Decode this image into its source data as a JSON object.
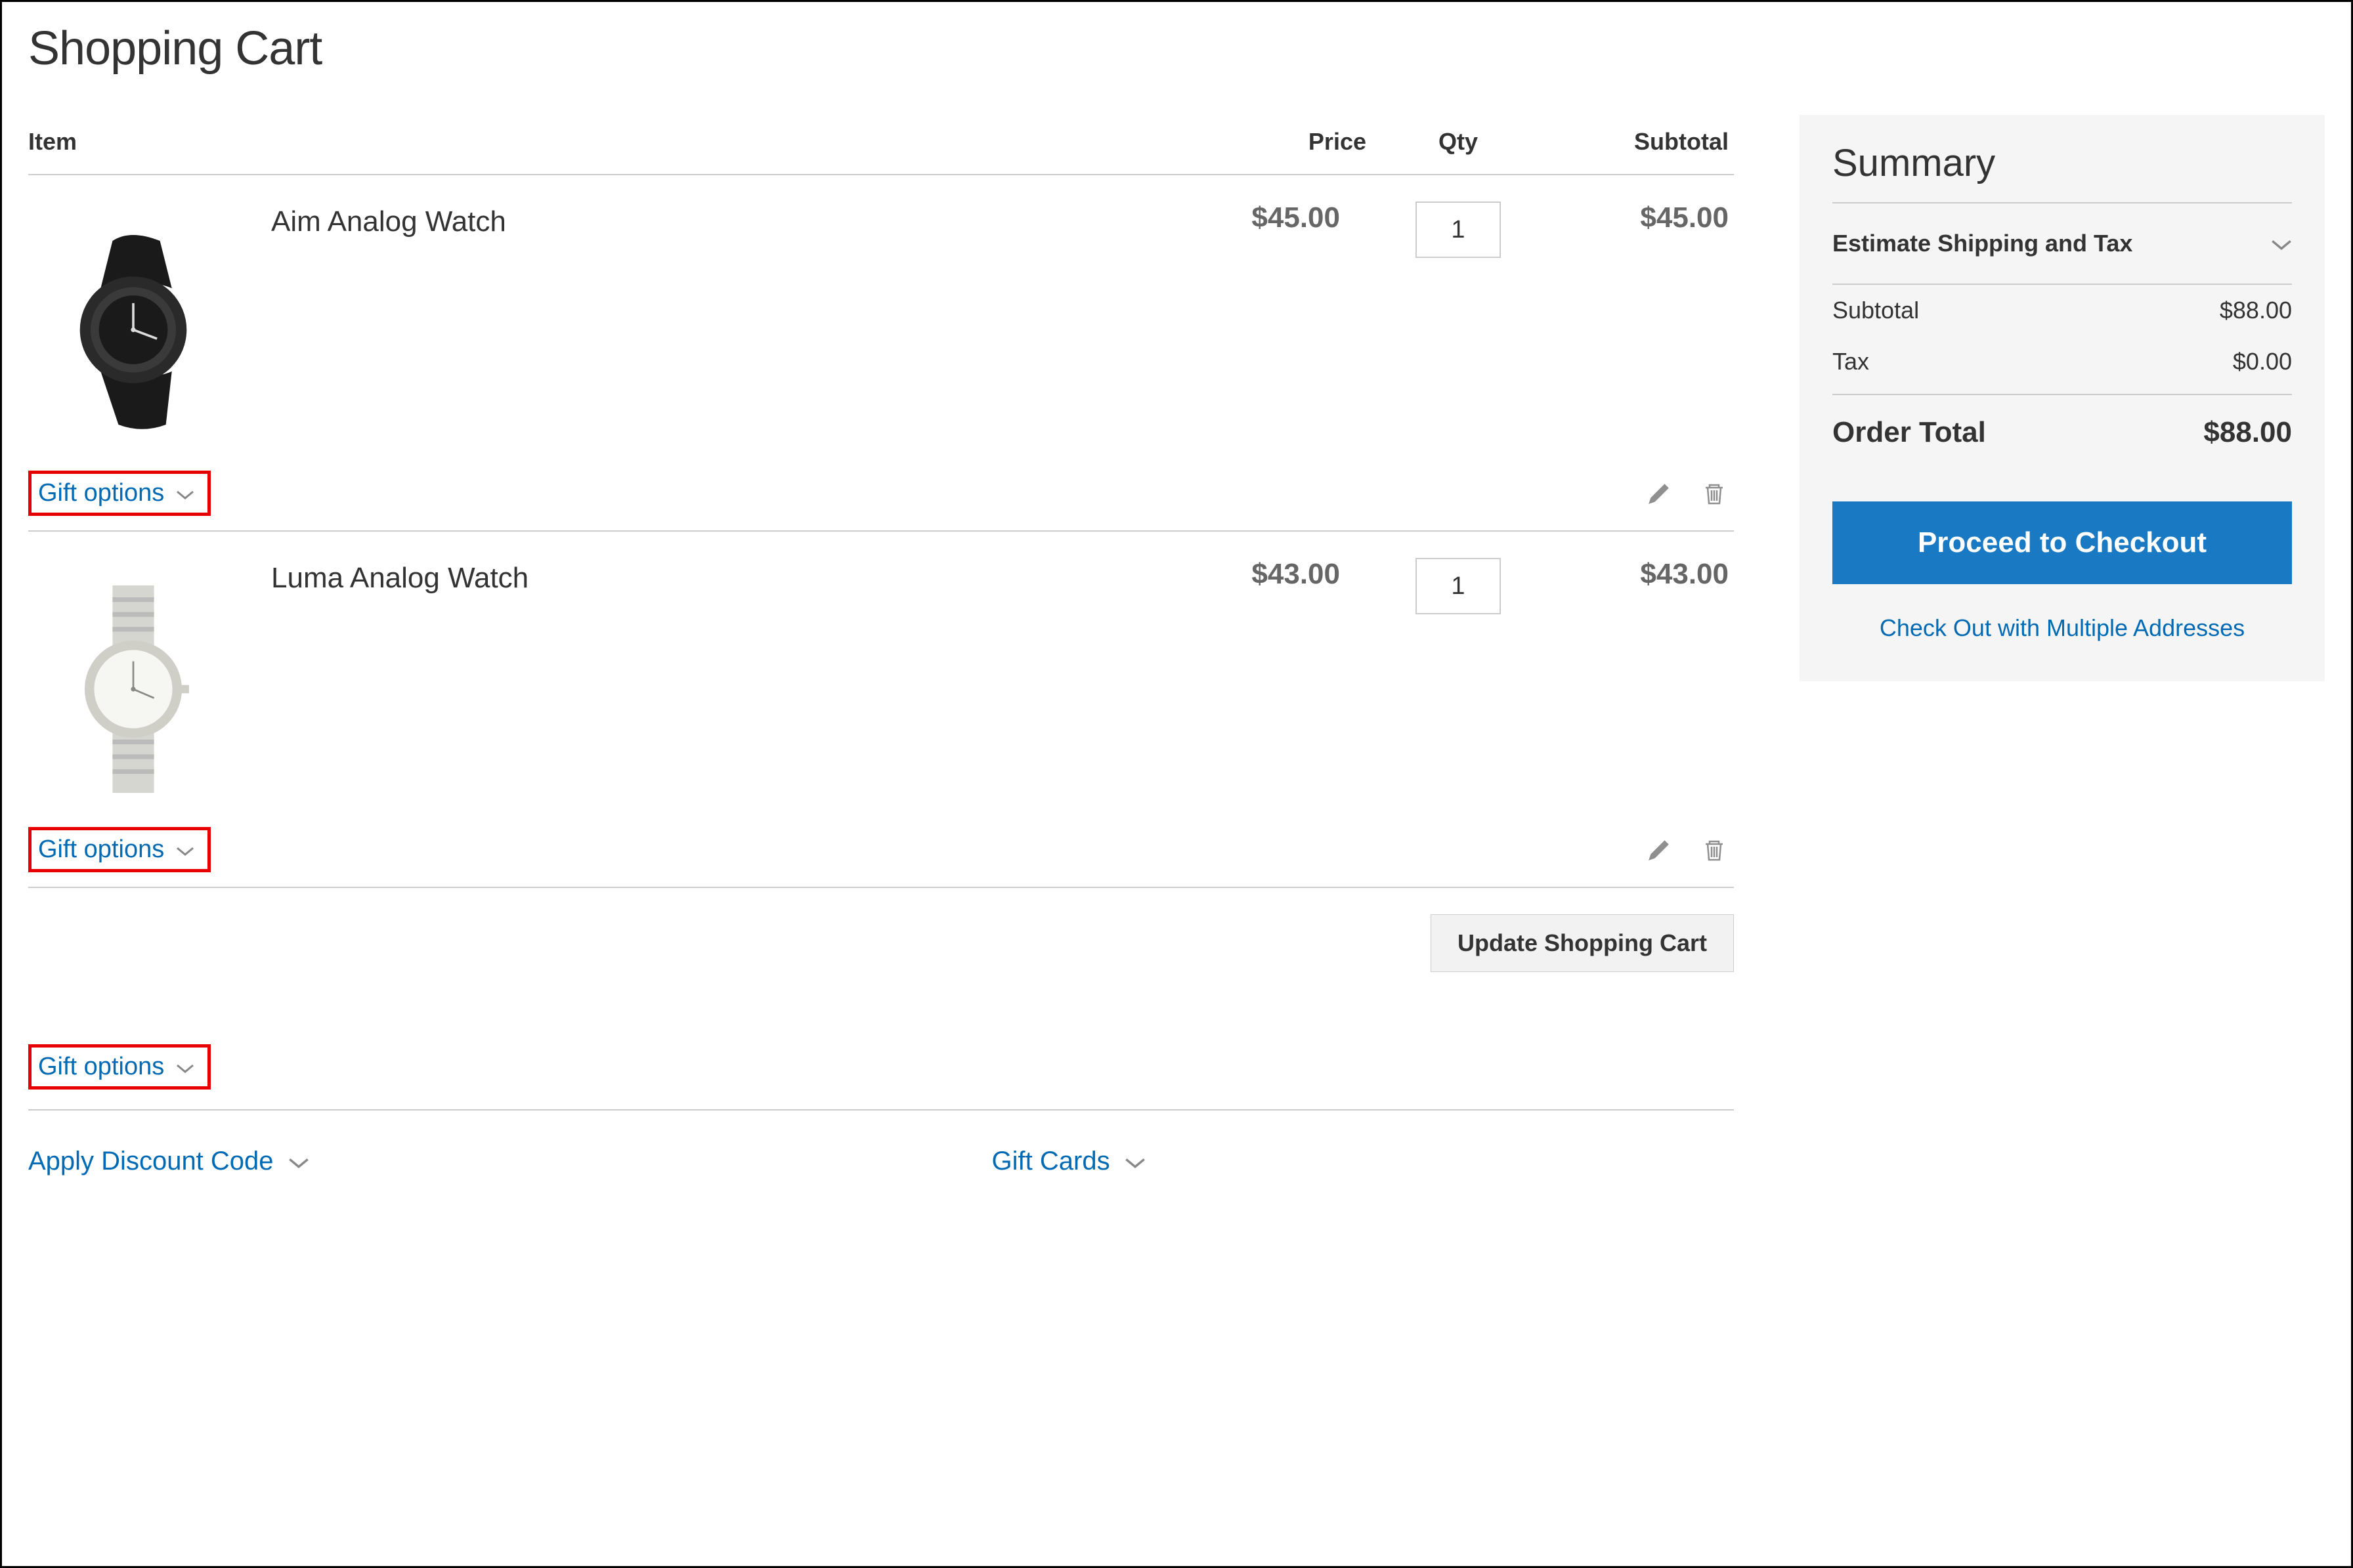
{
  "page_title": "Shopping Cart",
  "columns": {
    "item": "Item",
    "price": "Price",
    "qty": "Qty",
    "subtotal": "Subtotal"
  },
  "items": [
    {
      "name": "Aim Analog Watch",
      "price": "$45.00",
      "qty": "1",
      "subtotal": "$45.00",
      "gift_label": "Gift options"
    },
    {
      "name": "Luma Analog Watch",
      "price": "$43.00",
      "qty": "1",
      "subtotal": "$43.00",
      "gift_label": "Gift options"
    }
  ],
  "update_button": "Update Shopping Cart",
  "order_gift_label": "Gift options",
  "discount_label": "Apply Discount Code",
  "gift_cards_label": "Gift Cards",
  "summary": {
    "title": "Summary",
    "estimate_label": "Estimate Shipping and Tax",
    "subtotal_label": "Subtotal",
    "subtotal_value": "$88.00",
    "tax_label": "Tax",
    "tax_value": "$0.00",
    "total_label": "Order Total",
    "total_value": "$88.00",
    "checkout_button": "Proceed to Checkout",
    "multi_address_link": "Check Out with Multiple Addresses"
  }
}
